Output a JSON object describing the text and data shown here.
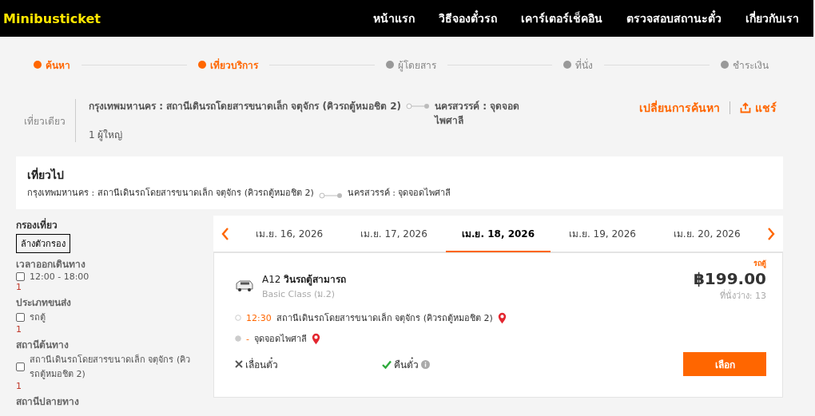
{
  "header": {
    "logo": "Minibusticket",
    "nav": [
      {
        "label": "หน้าแรก"
      },
      {
        "label": "วิธีจองตั๋วรถ"
      },
      {
        "label": "เคาร์เตอร์เช็คอิน"
      },
      {
        "label": "ตรวจสอบสถานะตั๋ว"
      },
      {
        "label": "เกี่ยวกับเรา"
      }
    ]
  },
  "steps": [
    {
      "label": "ค้นหา",
      "selected": true
    },
    {
      "label": "เที่ยวบริการ",
      "selected": true
    },
    {
      "label": "ผู้โดยสาร",
      "selected": false
    },
    {
      "label": "ที่นั่ง",
      "selected": false
    },
    {
      "label": "ชำระเงิน",
      "selected": false
    }
  ],
  "summary": {
    "trip_type": "เที่ยวเดียว",
    "origin": "กรุงเทพมหานคร : สถานีเดินรถโดยสารขนาดเล็ก จตุจักร (คิวรถตู้หมอชิต 2)",
    "destination": "นครสวรรค์ : จุดจอดไพศาลี",
    "passengers": "1 ผู้ใหญ่",
    "change_search": "เปลี่ยนการค้นหา",
    "share": "แชร์"
  },
  "outbound": {
    "title": "เที่ยวไป",
    "origin": "กรุงเทพมหานคร : สถานีเดินรถโดยสารขนาดเล็ก จตุจักร (คิวรถตู้หมอชิต 2)",
    "destination": "นครสวรรค์ : จุดจอดไพศาลี"
  },
  "filters": {
    "title": "กรองเที่ยว",
    "clear": "ล้างตัวกรอง",
    "groups": [
      {
        "title": "เวลาออกเดินทาง",
        "options": [
          {
            "label": "12:00 - 18:00",
            "count": "1",
            "checked": false
          }
        ]
      },
      {
        "title": "ประเภทขนส่ง",
        "options": [
          {
            "label": "รถตู้",
            "count": "1",
            "checked": false
          }
        ]
      },
      {
        "title": "สถานีต้นทาง",
        "options": [
          {
            "label": "สถานีเดินรถโดยสารขนาดเล็ก จตุจักร (คิวรถตู้หมอชิต 2)",
            "count": "1",
            "checked": false
          }
        ]
      },
      {
        "title": "สถานีปลายทาง"
      }
    ]
  },
  "dates": [
    {
      "label": "เม.ย. 16, 2026",
      "selected": false
    },
    {
      "label": "เม.ย. 17, 2026",
      "selected": false
    },
    {
      "label": "เม.ย. 18, 2026",
      "selected": true
    },
    {
      "label": "เม.ย. 19, 2026",
      "selected": false
    },
    {
      "label": "เม.ย. 20, 2026",
      "selected": false
    }
  ],
  "trip": {
    "type_tag": "รถตู้",
    "code": "A12",
    "operator": "วินรถตู้สามารถ",
    "class": "Basic Class (ม.2)",
    "price": "฿199.00",
    "seats": "ที่นั่งว่าง: 13",
    "depart_time": "12:30",
    "depart_station": "สถานีเดินรถโดยสารขนาดเล็ก จตุจักร (คิวรถตู้หมอชิต 2)",
    "arrive_time": "-",
    "arrive_station": "จุดจอดไพศาลี",
    "reschedule": {
      "label": "เลื่อนตั๋ว",
      "allowed": false
    },
    "refund": {
      "label": "คืนตั๋ว",
      "allowed": true
    },
    "select": "เลือก"
  }
}
